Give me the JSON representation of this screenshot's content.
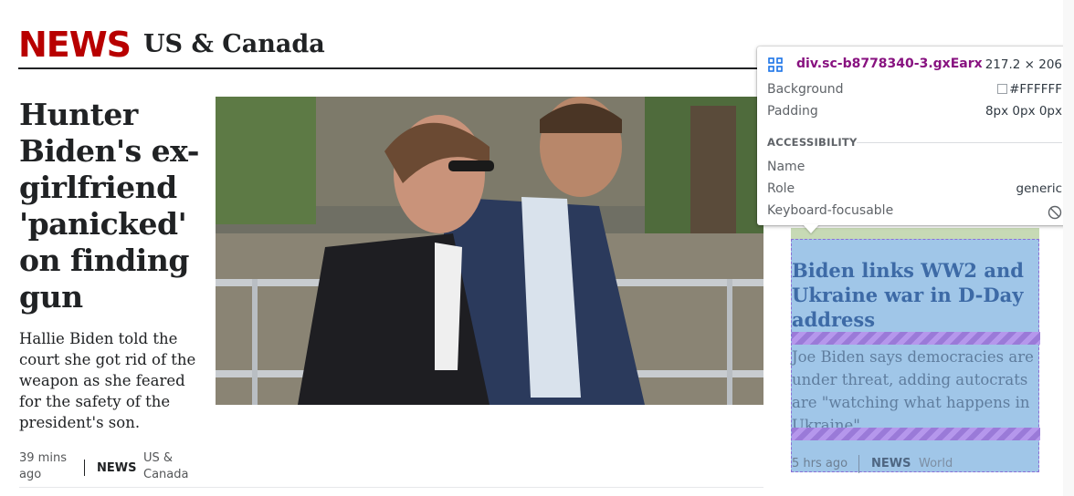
{
  "header": {
    "brand": "NEWS",
    "section_title": "US & Canada"
  },
  "lead_story": {
    "headline": "Hunter Biden's ex-girlfriend 'panicked' on finding gun",
    "summary": "Hallie Biden told the court she got rid of the weapon as she feared for the safety of the president's son.",
    "time": "39 mins ago",
    "brand": "NEWS",
    "section": "US & Canada"
  },
  "side_story": {
    "headline": "Biden links WW2 and Ukraine war in D-Day address",
    "summary": "Joe Biden says democracies are under threat, adding autocrats are \"watching what happens in Ukraine\".",
    "time": "5 hrs ago",
    "brand": "NEWS",
    "section": "World"
  },
  "inspector_tooltip": {
    "selector": "div.sc-b8778340-3.gxEarx",
    "size": "217.2 × 206",
    "background_label": "Background",
    "background_value": "#FFFFFF",
    "padding_label": "Padding",
    "padding_value": "8px 0px 0px",
    "section_label": "ACCESSIBILITY",
    "name_label": "Name",
    "name_value": "",
    "role_label": "Role",
    "role_value": "generic",
    "focusable_label": "Keyboard-focusable"
  },
  "colors": {
    "brand_red": "#b80000",
    "text_dark": "#202224",
    "overlay_blue": "#6fa8dc",
    "selector_purple": "#881280"
  }
}
